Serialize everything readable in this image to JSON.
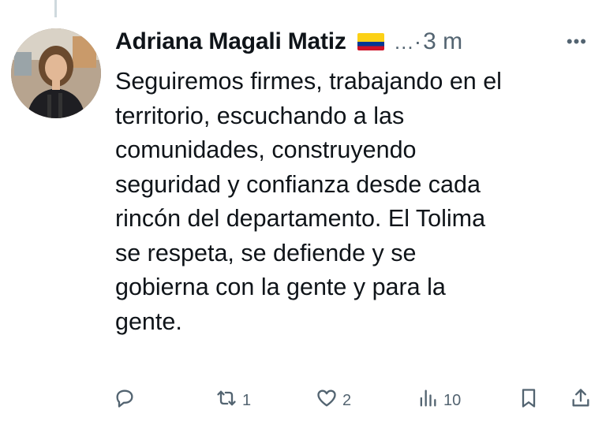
{
  "tweet": {
    "author_name": "Adriana Magali Matiz",
    "flag_icon": "colombia-flag-icon",
    "truncation": "…",
    "separator": "·",
    "time": "3 m",
    "more_icon": "more-options-icon",
    "text_lines": [
      "Seguiremos firmes, trabajando en el",
      "territorio, escuchando a las",
      "comunidades, construyendo",
      "seguridad y confianza desde cada",
      "rincón del departamento. El Tolima",
      "se respeta, se defiende y se",
      "gobierna con la gente y para la",
      "gente."
    ]
  },
  "actions": {
    "reply": {
      "icon": "reply-icon",
      "count": ""
    },
    "retweet": {
      "icon": "retweet-icon",
      "count": "1"
    },
    "like": {
      "icon": "heart-icon",
      "count": "2"
    },
    "views": {
      "icon": "views-icon",
      "count": "10"
    },
    "bookmark": {
      "icon": "bookmark-icon",
      "count": ""
    },
    "share": {
      "icon": "share-icon",
      "count": ""
    }
  },
  "colors": {
    "text": "#0f1419",
    "muted": "#536471",
    "thread_line": "#cfd9de"
  }
}
